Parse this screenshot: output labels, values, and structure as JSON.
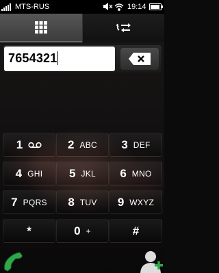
{
  "status_bar": {
    "carrier": "MTS-RUS",
    "time": "19:14"
  },
  "tabs": [
    {
      "name": "dialpad-grid-icon",
      "active": true
    },
    {
      "name": "call-log-arrows-icon",
      "active": false
    }
  ],
  "dialer": {
    "number": "7654321"
  },
  "keypad": {
    "keys": [
      {
        "digit": "1",
        "letters": ""
      },
      {
        "digit": "2",
        "letters": "ABC"
      },
      {
        "digit": "3",
        "letters": "DEF"
      },
      {
        "digit": "4",
        "letters": "GHI"
      },
      {
        "digit": "5",
        "letters": "JKL"
      },
      {
        "digit": "6",
        "letters": "MNO"
      },
      {
        "digit": "7",
        "letters": "PQRS"
      },
      {
        "digit": "8",
        "letters": "TUV"
      },
      {
        "digit": "9",
        "letters": "WXYZ"
      },
      {
        "digit": "*",
        "letters": ""
      },
      {
        "digit": "0",
        "letters": "+"
      },
      {
        "digit": "#",
        "letters": ""
      }
    ]
  },
  "colors": {
    "call_green": "#2fa84a",
    "accent_bg": "#0c0b0b"
  }
}
